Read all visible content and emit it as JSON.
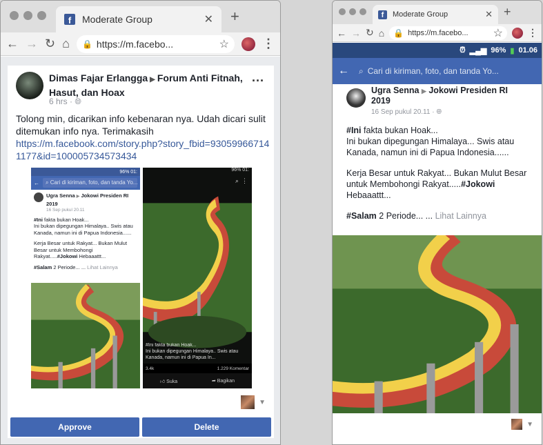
{
  "left": {
    "tab_title": "Moderate Group",
    "url": "https://m.facebo...",
    "post": {
      "author": "Dimas Fajar Erlangga",
      "group": "Forum Anti Fitnah, Hasut, dan Hoax",
      "time": "6 hrs",
      "text": "Tolong min, dicarikan info kebenaran nya. Udah dicari sulit ditemukan info nya. Terimakasih",
      "link": "https://m.facebook.com/story.php?story_fbid=930599667141177&id=100005734573434"
    },
    "approve_label": "Approve",
    "delete_label": "Delete"
  },
  "screenshot1": {
    "status": "96%  01:",
    "search_placeholder": "Cari di kiriman, foto, dan tanda Yo...",
    "author": "Ugra Senna",
    "group": "Jokowi Presiden RI 2019",
    "date": "16 Sep pukul 20.11",
    "line1_tag": "#Ini",
    "line1": "fakta bukan Hoak...",
    "line2": "Ini bukan dipegungan Himalaya.. Swis atau Kanada, namun ini di Papua Indonesia......",
    "line3": "Kerja Besar untuk Rakyat... Bukan Mulut Besar untuk Membohongi Rakyat.....",
    "line3_tag": "#Jokowi",
    "line3_end": "Hebaaattt...",
    "line4_tag": "#Salam",
    "line4": "2 Periode... ...",
    "more": "Lihat Lainnya"
  },
  "screenshot2": {
    "status": "96%  01:",
    "overlay_line1": "#Ini fakta bukan Hoak...",
    "overlay_line2": "Ini bukan dipegungan Himalaya.. Swis atau",
    "overlay_line3": "Kanada, namun ini di Papua In...",
    "reactions": "3.4k",
    "comments": "1.229 Komentar",
    "like": "Suka",
    "share": "Bagikan"
  },
  "right": {
    "tab_title": "Moderate Group",
    "url": "https://m.facebo...",
    "status": "96%",
    "time": "01.06",
    "search_placeholder": "Cari di kiriman, foto, dan tanda Yo...",
    "author": "Ugra Senna",
    "group": "Jokowi Presiden RI 2019",
    "date": "16 Sep pukul 20.11",
    "p1_tag": "#Ini",
    "p1": "fakta bukan Hoak...",
    "p1b": "Ini bukan dipegungan Himalaya... Swis atau Kanada, namun ini di Papua Indonesia......",
    "p2": "Kerja Besar untuk Rakyat... Bukan Mulut Besar untuk Membohongi Rakyat.....",
    "p2_tag": "#Jokowi",
    "p2_end": "Hebaaattt...",
    "p3_tag": "#Salam",
    "p3": "2 Periode... ...",
    "more": "Lihat Lainnya"
  },
  "colors": {
    "fb_blue": "#4267b2",
    "link": "#365899"
  },
  "icons": [
    "back-icon",
    "forward-icon",
    "reload-icon",
    "home-icon",
    "lock-icon",
    "star-icon",
    "kebab-icon",
    "close-icon",
    "new-tab-icon",
    "caret-down-icon",
    "search-icon"
  ]
}
